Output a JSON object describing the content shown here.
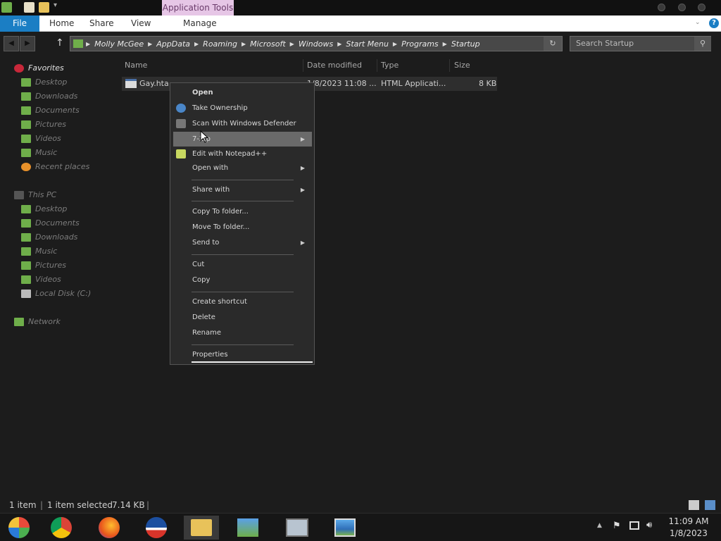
{
  "titlebar": {
    "contextual_tab": "Application Tools"
  },
  "ribbon": {
    "tabs": {
      "file": "File",
      "home": "Home",
      "share": "Share",
      "view": "View",
      "manage": "Manage"
    },
    "help": "?"
  },
  "address": {
    "crumbs": [
      "Molly McGee",
      "AppData",
      "Roaming",
      "Microsoft",
      "Windows",
      "Start Menu",
      "Programs",
      "Startup"
    ]
  },
  "search": {
    "placeholder": "Search Startup"
  },
  "sidebar": {
    "favorites": {
      "label": "Favorites",
      "items": [
        "Desktop",
        "Downloads",
        "Documents",
        "Pictures",
        "Videos",
        "Music",
        "Recent places"
      ]
    },
    "this_pc": {
      "label": "This PC",
      "items": [
        "Desktop",
        "Documents",
        "Downloads",
        "Music",
        "Pictures",
        "Videos",
        "Local Disk (C:)"
      ]
    },
    "network": {
      "label": "Network"
    }
  },
  "columns": {
    "name": "Name",
    "date": "Date modified",
    "type": "Type",
    "size": "Size"
  },
  "file": {
    "name": "Gay.hta",
    "date": "1/8/2023 11:08 ...",
    "type": "HTML Applicati...",
    "size": "8 KB"
  },
  "context_menu": {
    "open": "Open",
    "take_ownership": "Take Ownership",
    "scan": "Scan With Windows Defender",
    "sevenzip": "7-Zip",
    "notepad": "Edit with Notepad++",
    "open_with": "Open with",
    "share_with": "Share with",
    "copy_to": "Copy To folder...",
    "move_to": "Move To folder...",
    "send_to": "Send to",
    "cut": "Cut",
    "copy": "Copy",
    "create_shortcut": "Create shortcut",
    "delete": "Delete",
    "rename": "Rename",
    "properties": "Properties"
  },
  "status": {
    "items": "1 item",
    "selected": "1 item selected",
    "size": "7.14 KB"
  },
  "clock": {
    "time": "11:09 AM",
    "date": "1/8/2023"
  },
  "colors": {
    "accent": "#1b7ec4",
    "contextual_tab": "#e6c6e6",
    "background": "#1c1c1c"
  }
}
